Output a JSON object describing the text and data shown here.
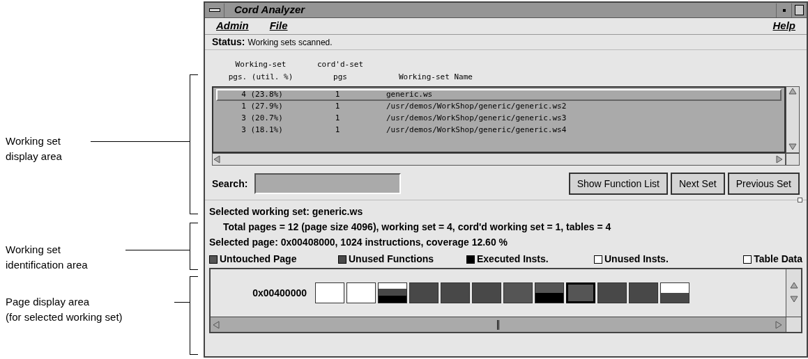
{
  "callouts": [
    {
      "lines": [
        "Working set",
        "display area"
      ]
    },
    {
      "lines": [
        "Working set",
        "identification area"
      ]
    },
    {
      "lines": [
        "Page display area",
        "(for selected working set)"
      ]
    }
  ],
  "window": {
    "title": "Cord Analyzer"
  },
  "menu": {
    "left": [
      "Admin",
      "File"
    ],
    "right": "Help"
  },
  "status": {
    "label": "Status:",
    "text": "Working sets scanned."
  },
  "list": {
    "headers": [
      {
        "top": "Working-set",
        "bottom": "pgs. (util. %)"
      },
      {
        "top": "cord'd-set",
        "bottom": "pgs"
      },
      {
        "bottom": "Working-set Name"
      }
    ],
    "rows": [
      {
        "pages": "4 (23.8%)",
        "cord": "1",
        "name": "generic.ws",
        "selected": true
      },
      {
        "pages": "1 (27.9%)",
        "cord": "1",
        "name": "/usr/demos/WorkShop/generic/generic.ws2",
        "selected": false
      },
      {
        "pages": "3 (20.7%)",
        "cord": "1",
        "name": "/usr/demos/WorkShop/generic/generic.ws3",
        "selected": false
      },
      {
        "pages": "3 (18.1%)",
        "cord": "1",
        "name": "/usr/demos/WorkShop/generic/generic.ws4",
        "selected": false
      }
    ]
  },
  "search": {
    "label": "Search:"
  },
  "buttons": [
    "Show Function List",
    "Next Set",
    "Previous Set"
  ],
  "info": {
    "selected_set": "Selected working set: generic.ws",
    "totals": "Total pages = 12 (page size 4096), working set = 4, cord'd working set = 1, tables = 4",
    "selected_page": "Selected page: 0x00408000,  1024 instructions, coverage 12.60 %"
  },
  "legend": [
    {
      "label": "Untouched Page",
      "color": "#555555"
    },
    {
      "label": "Unused Functions",
      "color": "#484848"
    },
    {
      "label": "Executed Insts.",
      "color": "#000000"
    },
    {
      "label": "Unused Insts.",
      "color": "#ffffff"
    },
    {
      "label": "Table Data",
      "color": "#ffffff"
    }
  ],
  "pages": {
    "address": "0x00400000",
    "cells": [
      {
        "layers": [
          {
            "kind": "unused_insts"
          }
        ],
        "selected": false
      },
      {
        "layers": [
          {
            "kind": "unused_insts"
          }
        ],
        "selected": false
      },
      {
        "layers": [
          {
            "kind": "table_data"
          },
          {
            "kind": "unused_functions"
          },
          {
            "kind": "executed"
          }
        ],
        "selected": false
      },
      {
        "layers": [
          {
            "kind": "unused_functions"
          }
        ],
        "selected": false
      },
      {
        "layers": [
          {
            "kind": "unused_functions"
          }
        ],
        "selected": false
      },
      {
        "layers": [
          {
            "kind": "unused_functions"
          }
        ],
        "selected": false
      },
      {
        "layers": [
          {
            "kind": "untouched"
          }
        ],
        "selected": false
      },
      {
        "layers": [
          {
            "kind": "untouched"
          },
          {
            "kind": "executed"
          }
        ],
        "selected": false
      },
      {
        "layers": [
          {
            "kind": "untouched"
          }
        ],
        "selected": true
      },
      {
        "layers": [
          {
            "kind": "unused_functions"
          }
        ],
        "selected": false
      },
      {
        "layers": [
          {
            "kind": "unused_functions"
          }
        ],
        "selected": false
      },
      {
        "layers": [
          {
            "kind": "table_data"
          },
          {
            "kind": "unused_functions"
          }
        ],
        "selected": false
      }
    ]
  }
}
